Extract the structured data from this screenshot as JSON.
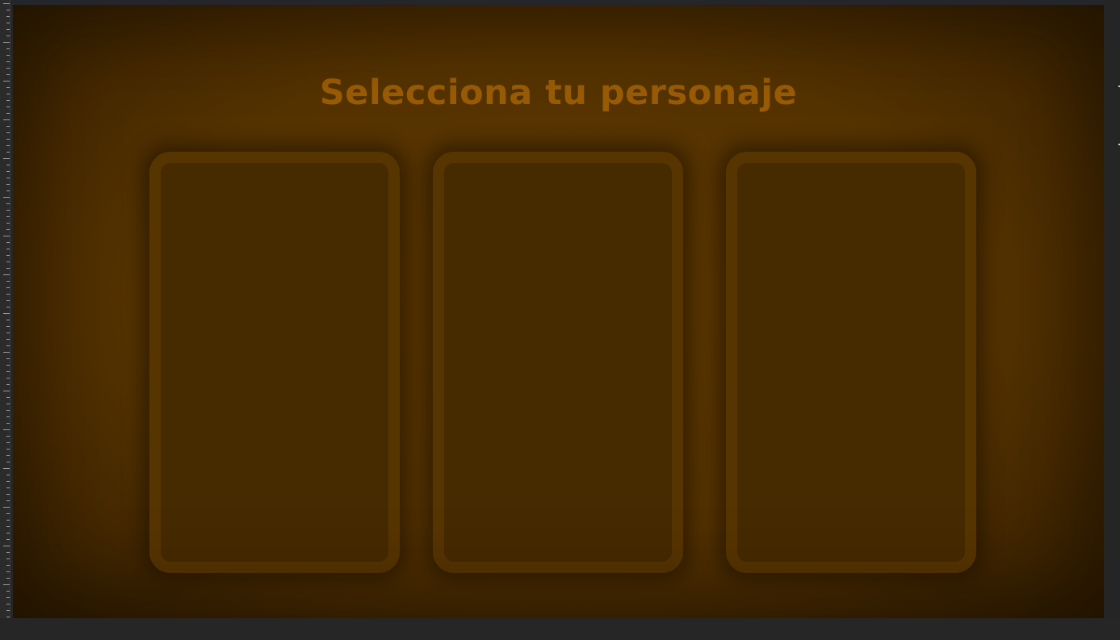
{
  "screen": {
    "title": "Selecciona tu personaje"
  },
  "character_cards": [
    {
      "id": "card-1"
    },
    {
      "id": "card-2"
    },
    {
      "id": "card-3"
    }
  ],
  "colors": {
    "background": "#553300",
    "title": "#9a5c06",
    "card_border": "#573500",
    "card_fill": "#472b00",
    "editor_chrome": "#262626"
  }
}
